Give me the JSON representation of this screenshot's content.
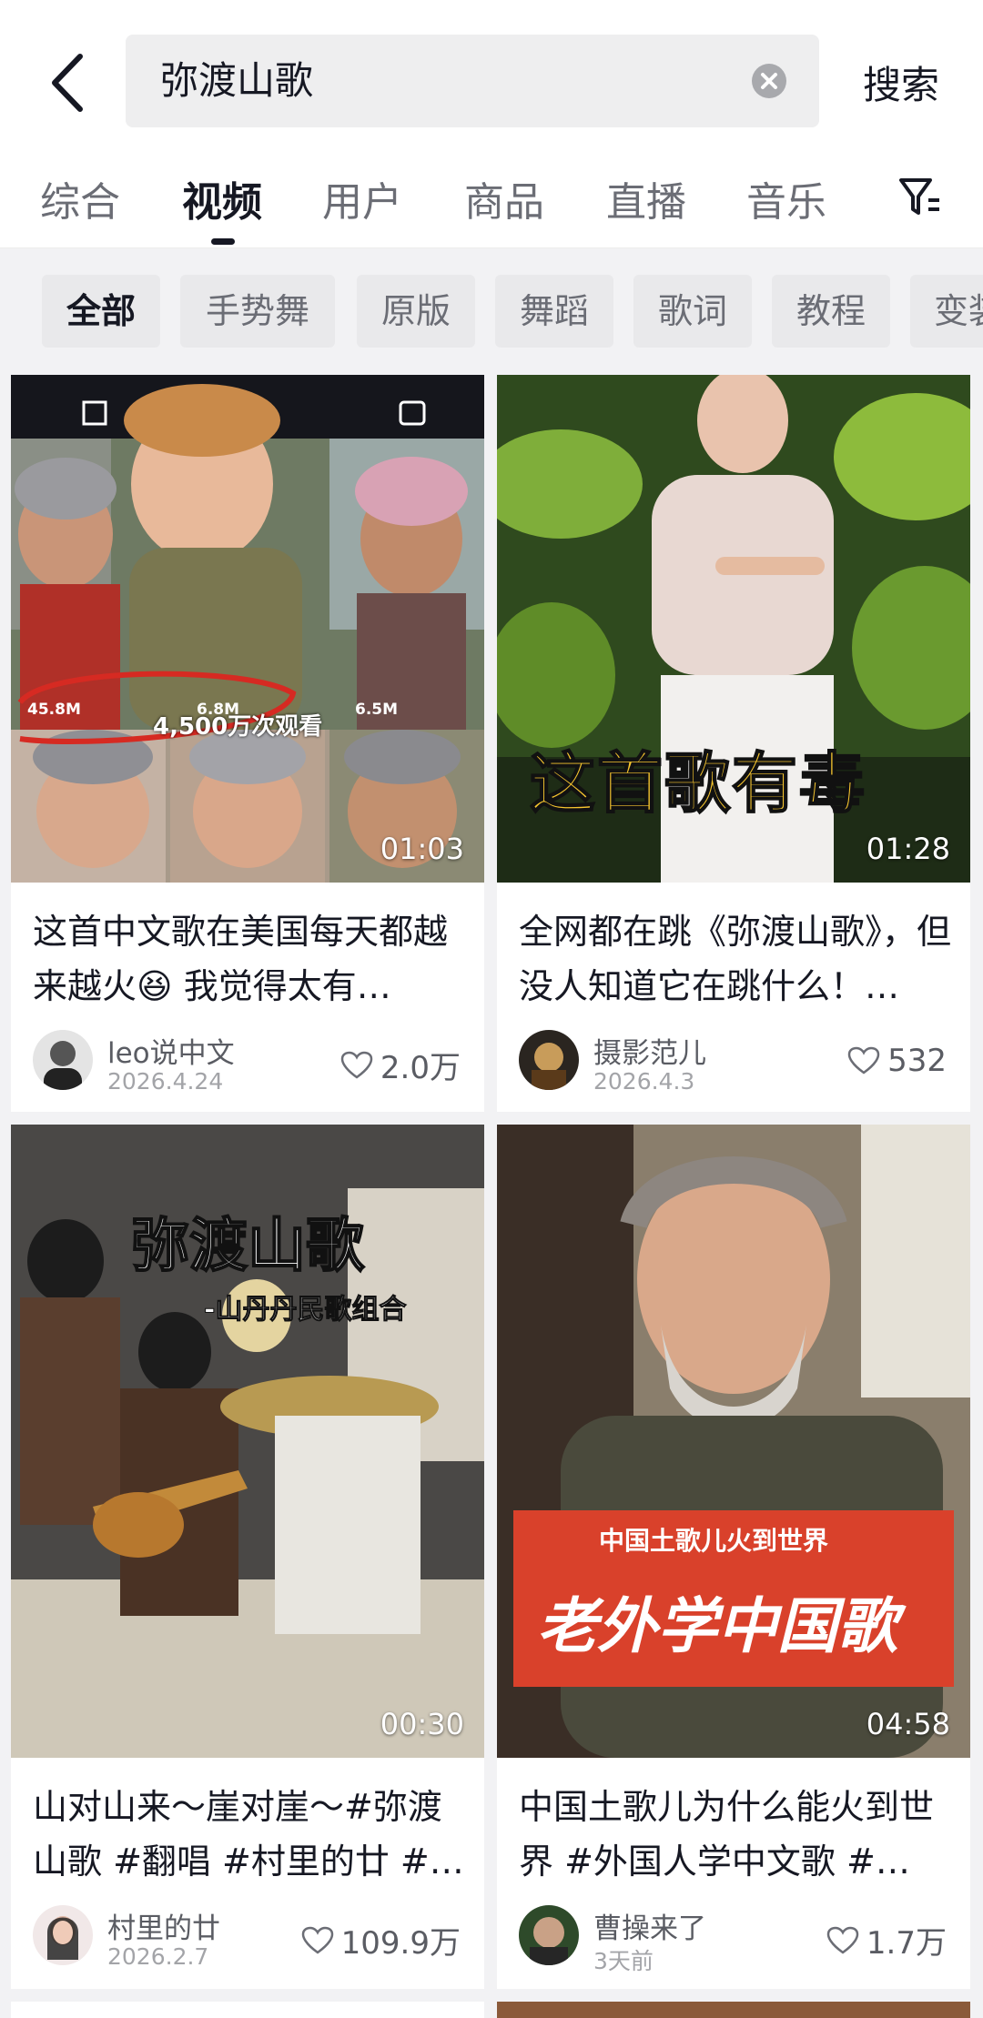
{
  "search": {
    "query": "弥渡山歌",
    "button_label": "搜索"
  },
  "tabs": [
    {
      "label": "综合"
    },
    {
      "label": "视频"
    },
    {
      "label": "用户"
    },
    {
      "label": "商品"
    },
    {
      "label": "直播"
    },
    {
      "label": "音乐"
    }
  ],
  "active_tab": "视频",
  "chips": [
    {
      "label": "全部"
    },
    {
      "label": "手势舞"
    },
    {
      "label": "原版"
    },
    {
      "label": "舞蹈"
    },
    {
      "label": "歌词"
    },
    {
      "label": "教程"
    },
    {
      "label": "变装"
    }
  ],
  "cards": [
    {
      "title": "这首中文歌在美国每天都越来越火😆 我觉得太有…",
      "duration": "01:03",
      "author": "leo说中文",
      "date": "2026.4.24",
      "likes": "2.0万",
      "overlay": {
        "views": "4,500万次观看",
        "stat1": "45.8M",
        "stat2": "6.8M",
        "stat3": "6.5M"
      }
    },
    {
      "title": "全网都在跳《弥渡山歌》，但没人知道它在跳什么！…",
      "duration": "01:28",
      "author": "摄影范儿",
      "date": "2026.4.3",
      "likes": "532",
      "overlay": {
        "caption": "这首歌有毒"
      }
    },
    {
      "title": "山对山来～崖对崖～#弥渡山歌 #翻唱 #村里的廿 #…",
      "duration": "00:30",
      "author": "村里的廿",
      "date": "2026.2.7",
      "likes": "109.9万",
      "overlay": {
        "caption": "弥渡山歌",
        "subcaption": "-山丹丹民歌组合"
      }
    },
    {
      "title": "中国土歌儿为什么能火到世界 #外国人学中文歌 #…",
      "duration": "04:58",
      "author": "曹操来了",
      "date": "3天前",
      "likes": "1.7万",
      "overlay": {
        "caption": "老外学中国歌",
        "subcaption": "中国土歌儿火到世界"
      }
    }
  ],
  "colors": {
    "accent_text": "#161823",
    "secondary_text": "#6b6d75",
    "banner_yellow": "#f7c62f",
    "banner_red": "#d9412b"
  }
}
